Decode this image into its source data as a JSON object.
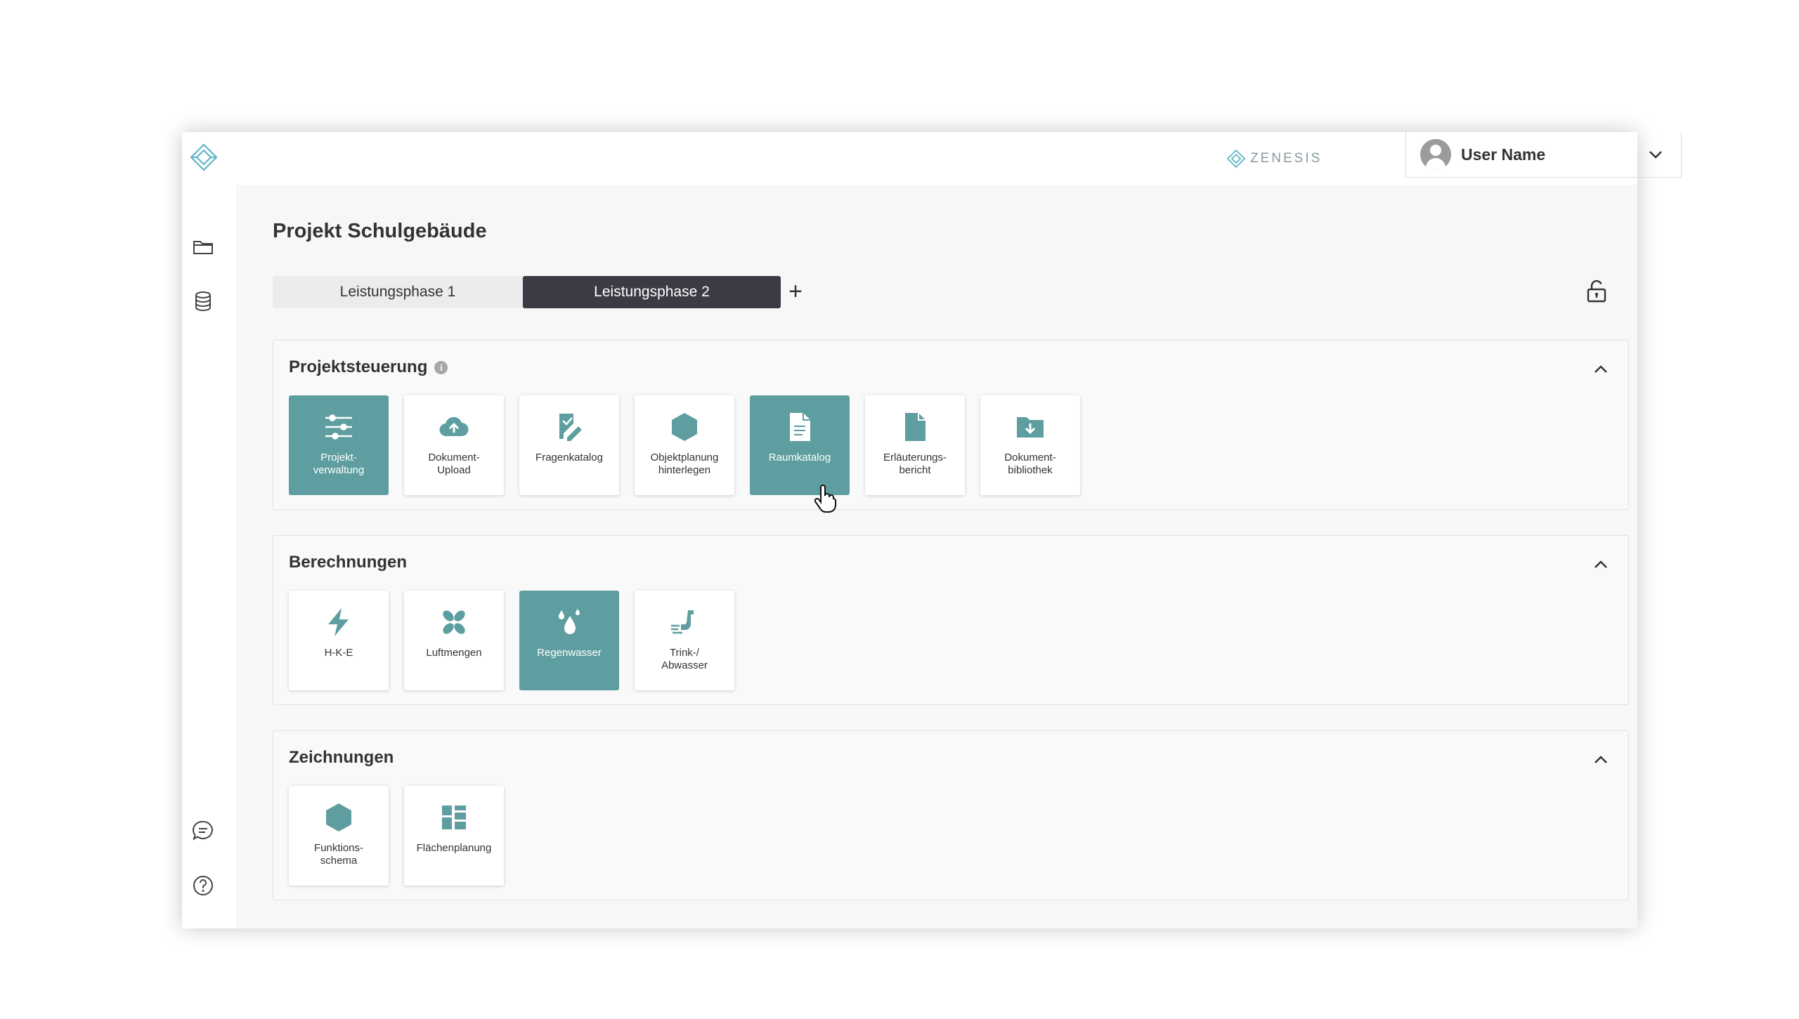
{
  "app": {
    "brand": "ZENESIS"
  },
  "user": {
    "name": "User Name"
  },
  "page": {
    "title": "Projekt Schulgebäude"
  },
  "tabs": [
    {
      "label": "Leistungsphase 1",
      "active": false
    },
    {
      "label": "Leistungsphase 2",
      "active": true
    }
  ],
  "tab_add_label": "+",
  "sections": [
    {
      "title": "Projektsteuerung",
      "info": "i",
      "cards": [
        {
          "label": "Projekt-\nverwaltung",
          "icon": "sliders-icon",
          "active": true
        },
        {
          "label": "Dokument-\nUpload",
          "icon": "cloud-upload-icon",
          "active": false
        },
        {
          "label": "Fragenkatalog",
          "icon": "edit-document-icon",
          "active": false
        },
        {
          "label": "Objektplanung\nhinterlegen",
          "icon": "hexagon-icon",
          "active": false
        },
        {
          "label": "Raumkatalog",
          "icon": "document-icon",
          "active": true
        },
        {
          "label": "Erläuterungs-\nbericht",
          "icon": "file-icon",
          "active": false
        },
        {
          "label": "Dokument-\nbibliothek",
          "icon": "folder-download-icon",
          "active": false
        }
      ]
    },
    {
      "title": "Berechnungen",
      "cards": [
        {
          "label": "H-K-E",
          "icon": "bolt-icon",
          "active": false
        },
        {
          "label": "Luftmengen",
          "icon": "fan-icon",
          "active": false
        },
        {
          "label": "Regenwasser",
          "icon": "water-drops-icon",
          "active": true
        },
        {
          "label": "Trink-/\nAbwasser",
          "icon": "pipe-icon",
          "active": false
        }
      ]
    },
    {
      "title": "Zeichnungen",
      "cards": [
        {
          "label": "Funktions-\nschema",
          "icon": "hexagon-icon",
          "active": false
        },
        {
          "label": "Flächenplanung",
          "icon": "floorplan-icon",
          "active": false
        }
      ]
    }
  ],
  "colors": {
    "accent": "#5f9ea0",
    "tab_active": "#3a3b45",
    "icon": "#5f9ea0"
  }
}
